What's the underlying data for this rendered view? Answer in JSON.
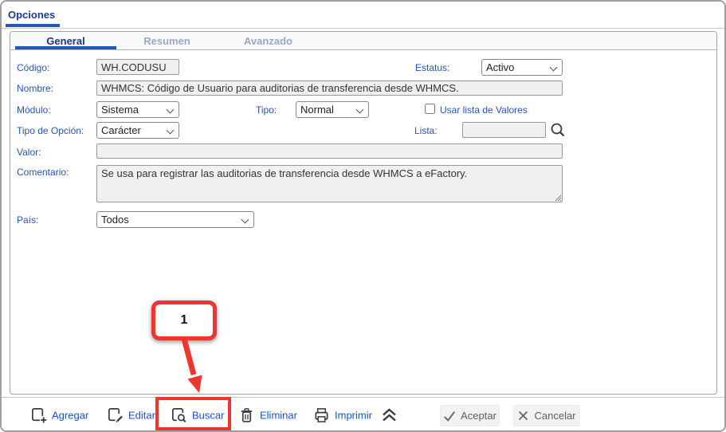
{
  "window": {
    "title": "Opciones"
  },
  "tabs": [
    {
      "label": "General",
      "active": true
    },
    {
      "label": "Resumen",
      "active": false
    },
    {
      "label": "Avanzado",
      "active": false
    }
  ],
  "form": {
    "codigo": {
      "label": "Código:",
      "value": "WH.CODUSU"
    },
    "estatus": {
      "label": "Estatus:",
      "value": "Activo"
    },
    "nombre": {
      "label": "Nombre:",
      "value": "WHMCS: Código de Usuario para auditorias de transferencia desde WHMCS."
    },
    "modulo": {
      "label": "Módulo:",
      "value": "Sistema"
    },
    "tipo": {
      "label": "Tipo:",
      "value": "Normal"
    },
    "usar_lista": {
      "label": "Usar lista de Valores",
      "checked": false
    },
    "tipo_opcion": {
      "label": "Tipo de Opción:",
      "value": "Carácter"
    },
    "lista": {
      "label": "Lista:",
      "value": ""
    },
    "valor": {
      "label": "Valor:",
      "value": ""
    },
    "comentario": {
      "label": "Comentario:",
      "value": "Se usa para registrar las auditorias de transferencia desde WHMCS a eFactory."
    },
    "pais": {
      "label": "País:",
      "value": "Todos"
    }
  },
  "toolbar": {
    "agregar": "Agregar",
    "editar": "Editar",
    "buscar": "Buscar",
    "eliminar": "Eliminar",
    "imprimir": "Imprimir",
    "aceptar": "Aceptar",
    "cancelar": "Cancelar"
  },
  "annotation": {
    "step": "1"
  },
  "icons": {
    "agregar": "document-plus-icon",
    "editar": "document-pencil-icon",
    "buscar": "document-search-icon",
    "eliminar": "trash-icon",
    "imprimir": "printer-icon",
    "collapse": "double-chevron-up-icon",
    "aceptar": "check-icon",
    "cancelar": "x-icon",
    "lista": "magnifier-icon"
  },
  "colors": {
    "accent_blue": "#2057b8",
    "label_blue": "#2a55ad",
    "link_blue": "#1853c6",
    "tab_active": "#17377e",
    "tab_inactive": "#97a9cb",
    "annotation_red": "#ee352e",
    "input_bg": "#f0f0f0"
  }
}
